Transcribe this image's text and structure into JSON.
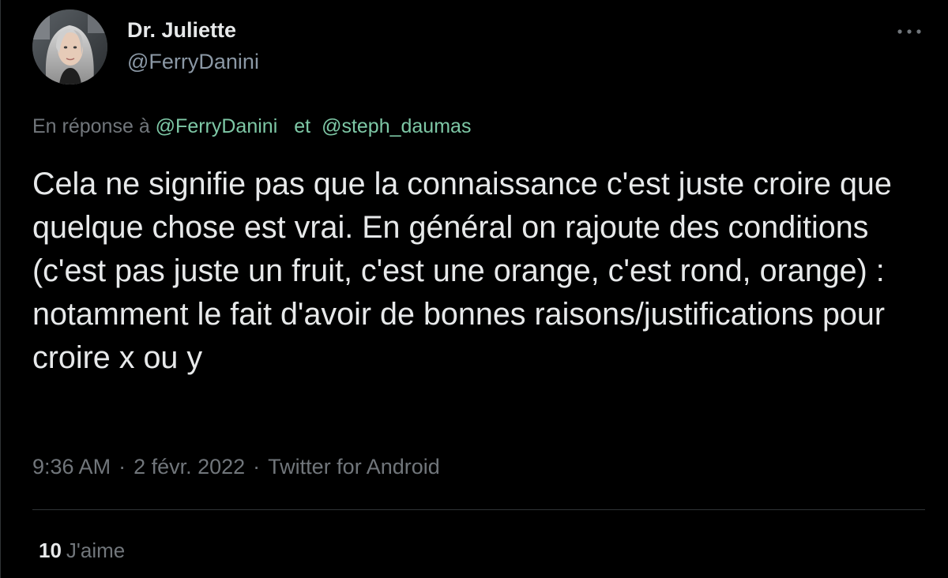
{
  "author": {
    "name": "Dr. Juliette",
    "handle": "@FerryDanini"
  },
  "reply": {
    "prefix": "En réponse à",
    "mentions": [
      "@FerryDanini",
      "@steph_daumas"
    ],
    "joiner": "et"
  },
  "tweet": {
    "text": "Cela ne signifie pas que la connaissance c'est juste croire que quelque chose est vrai. En général on rajoute des conditions (c'est pas juste un fruit, c'est une orange, c'est rond, orange) : notamment le fait d'avoir de bonnes raisons/justifications pour croire x ou y"
  },
  "meta": {
    "time": "9:36 AM",
    "date": "2 févr. 2022",
    "source": "Twitter for Android",
    "separator": "·"
  },
  "engagement": {
    "likes_count": "10",
    "likes_label": "J'aime"
  },
  "icons": {
    "more": "more-horizontal-icon"
  },
  "colors": {
    "background": "#000000",
    "text_primary": "#e7e9ea",
    "text_secondary": "#71767b",
    "mention": "#7ec8a6",
    "divider": "#2f3336"
  }
}
